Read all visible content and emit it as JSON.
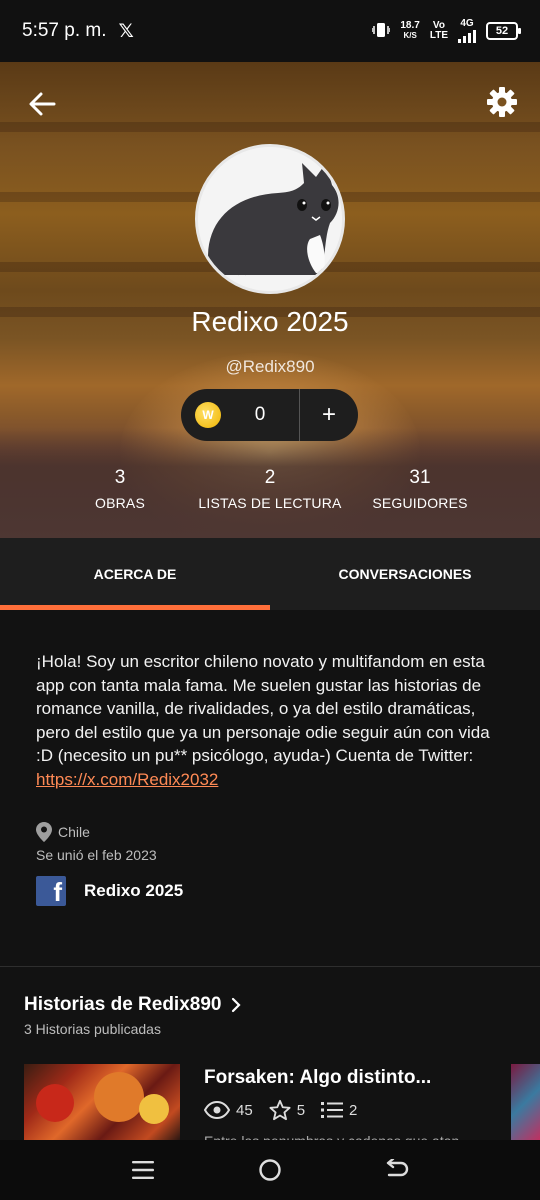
{
  "status_bar": {
    "time": "5:57 p. m.",
    "x_icon": "𝕏",
    "net_speed_top": "18.7",
    "net_speed_bottom": "K/S",
    "volte_top": "Vo",
    "volte_bottom": "LTE",
    "network": "4G",
    "battery": "52"
  },
  "profile": {
    "name": "Redixo 2025",
    "handle": "@Redix890",
    "coins": "0",
    "coin_symbol": "W",
    "plus": "+"
  },
  "stats": [
    {
      "value": "3",
      "label": "OBRAS"
    },
    {
      "value": "2",
      "label": "LISTAS DE LECTURA"
    },
    {
      "value": "31",
      "label": "SEGUIDORES"
    }
  ],
  "tabs": [
    {
      "label": "ACERCA DE",
      "active": true
    },
    {
      "label": "CONVERSACIONES",
      "active": false
    }
  ],
  "about": {
    "description": "¡Hola! Soy un escritor chileno novato y multifandom en esta app con tanta mala fama. Me suelen gustar las historias de romance vanilla, de rivalidades, o ya del estilo dramáticas, pero del estilo que ya un personaje odie seguir aún con vida :D (necesito un pu** psicólogo, ayuda-) Cuenta de Twitter: ",
    "link": "https://x.com/Redix2032",
    "location": "Chile",
    "joined": "Se unió el feb 2023",
    "facebook_name": "Redixo 2025"
  },
  "stories": {
    "title": "Historias de Redix890",
    "subtitle": "3 Historias publicadas",
    "items": [
      {
        "title": "Forsaken: Algo distinto...",
        "reads": "45",
        "votes": "5",
        "parts": "2",
        "description": "Entre las penumbras y cadenas que atan"
      }
    ]
  },
  "colors": {
    "accent": "#ff6f3a",
    "link": "#ff8a55",
    "background": "#121212",
    "facebook": "#3b5998"
  },
  "icons": [
    "back-arrow-icon",
    "gear-icon",
    "coin-icon",
    "plus-icon",
    "location-pin-icon",
    "facebook-icon",
    "chevron-right-icon",
    "eye-icon",
    "star-icon",
    "list-icon",
    "menu-icon",
    "home-circle-icon",
    "back-nav-icon"
  ]
}
